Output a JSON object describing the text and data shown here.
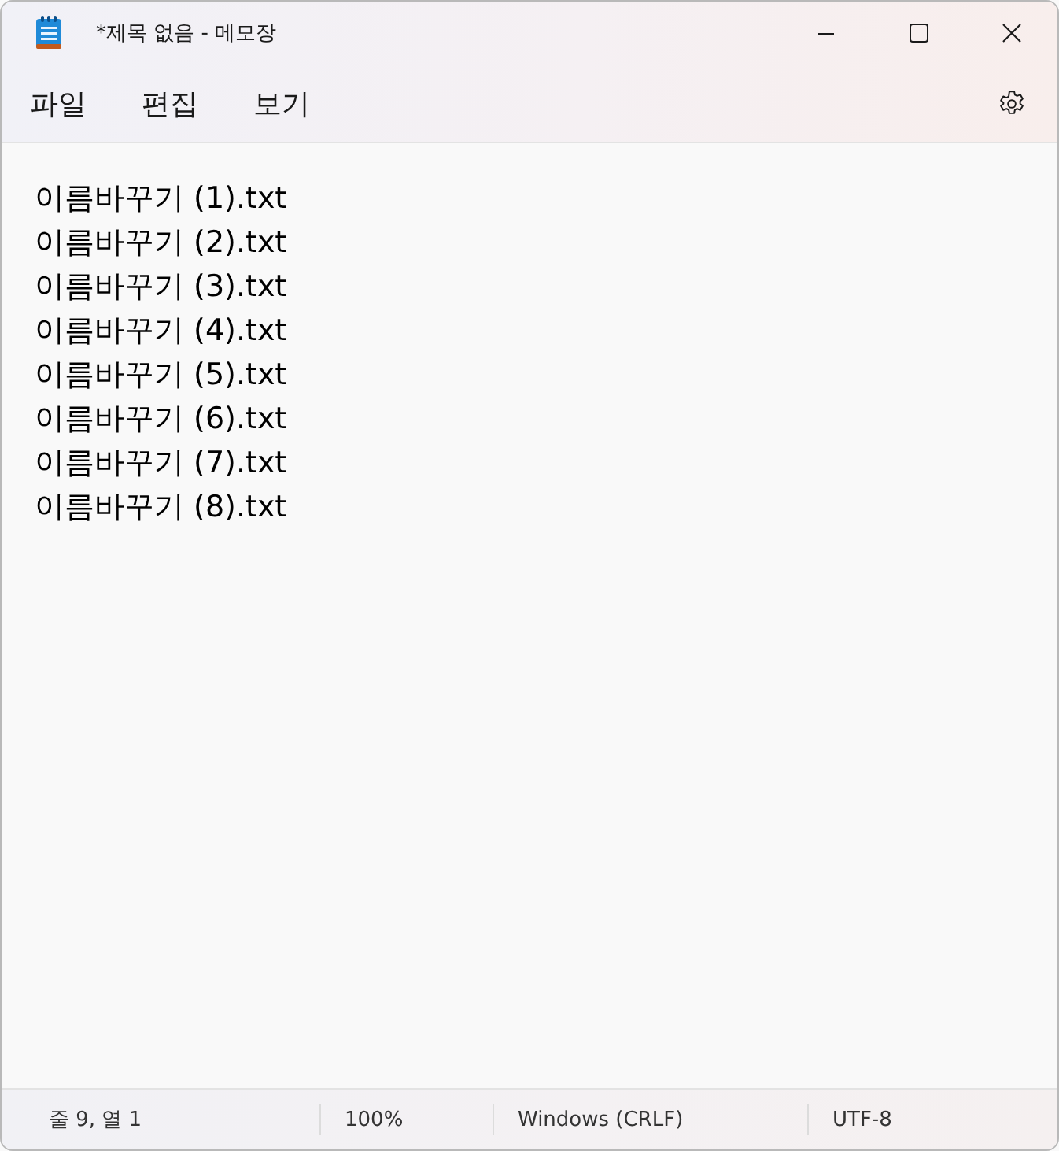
{
  "window": {
    "title": "*제목 없음 - 메모장"
  },
  "menu": [
    {
      "label": "파일"
    },
    {
      "label": "편집"
    },
    {
      "label": "보기"
    }
  ],
  "editor": {
    "lines": [
      "이름바꾸기 (1).txt",
      "이름바꾸기 (2).txt",
      "이름바꾸기 (3).txt",
      "이름바꾸기 (4).txt",
      "이름바꾸기 (5).txt",
      "이름바꾸기 (6).txt",
      "이름바꾸기 (7).txt",
      "이름바꾸기 (8).txt"
    ]
  },
  "status_bar": {
    "items": [
      {
        "kind": "position",
        "text": "줄 9, 열 1"
      },
      {
        "kind": "zoom",
        "text": "100%"
      },
      {
        "kind": "line-ending",
        "text": "Windows (CRLF)"
      },
      {
        "kind": "encoding",
        "text": "UTF-8"
      }
    ]
  }
}
